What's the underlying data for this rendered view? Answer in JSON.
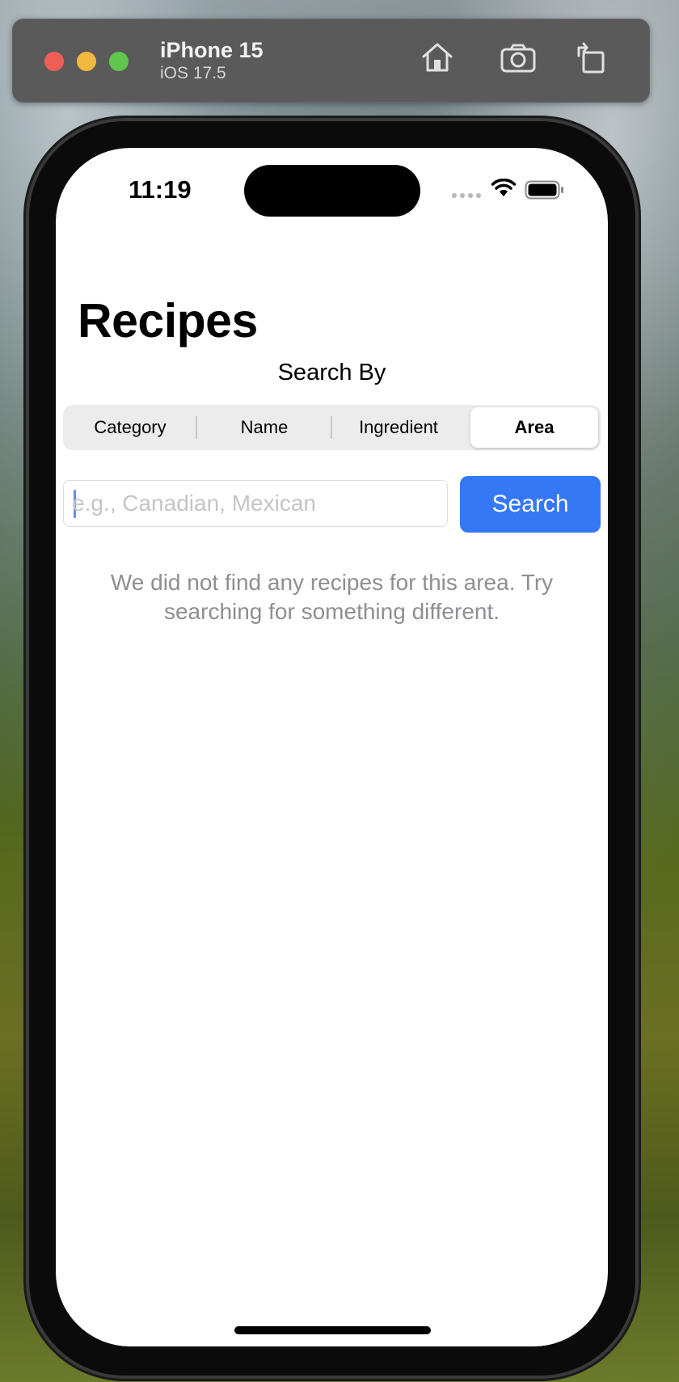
{
  "simulator": {
    "device_name": "iPhone 15",
    "os_version": "iOS 17.5",
    "icons": [
      "home-icon",
      "screenshot-icon",
      "rotate-icon"
    ]
  },
  "status_bar": {
    "time": "11:19",
    "icons": [
      "cellular-icon",
      "wifi-icon",
      "battery-icon"
    ]
  },
  "screen": {
    "title": "Recipes",
    "search_by_label": "Search By",
    "segments": [
      {
        "label": "Category",
        "selected": false
      },
      {
        "label": "Name",
        "selected": false
      },
      {
        "label": "Ingredient",
        "selected": false
      },
      {
        "label": "Area",
        "selected": true
      }
    ],
    "search": {
      "placeholder": "e.g., Canadian, Mexican",
      "value": "",
      "button_label": "Search"
    },
    "empty_message": "We did not find any recipes for this area. Try searching for something different."
  },
  "colors": {
    "accent": "#3478f6",
    "secondary_text": "#8e8e93",
    "segment_background": "#ececed"
  }
}
